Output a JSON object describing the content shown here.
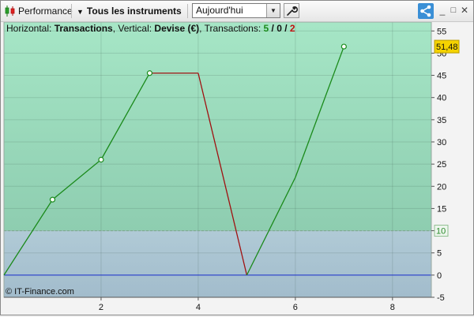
{
  "toolbar": {
    "performance_label": "Performance",
    "instruments_label": "Tous les instruments",
    "period_value": "Aujourd'hui"
  },
  "legend": {
    "horizontal_prefix": "Horizontal: ",
    "horizontal_value": "Transactions",
    "vertical_prefix": ", Vertical: ",
    "vertical_value": "Devise (€)",
    "transactions_prefix": ", Transactions: ",
    "tx_winning": "5",
    "tx_sep1": " / ",
    "tx_neutral": "0",
    "tx_sep2": " / ",
    "tx_losing": "2"
  },
  "copyright": "© IT-Finance.com",
  "colors": {
    "profit_zone": "#a3e0c2",
    "loss_zone": "#a8c4d6",
    "gain_line": "#1a8a1a",
    "loss_line": "#a01010",
    "zero_line": "#1a2fd0",
    "last_value_badge": "#f5d300"
  },
  "icons": [
    "candlestick-icon",
    "chevron-down-icon",
    "wrench-icon",
    "share-icon",
    "minimize-icon",
    "maximize-icon",
    "close-icon"
  ],
  "chart_data": {
    "type": "line",
    "x": [
      0,
      1,
      2,
      3,
      4,
      5,
      6,
      7
    ],
    "y": [
      0,
      17,
      26,
      45.5,
      45.5,
      0,
      22,
      51.48
    ],
    "segment_colors": [
      "gain",
      "gain",
      "gain",
      "flat",
      "loss",
      "gain",
      "gain"
    ],
    "marked_points": [
      1,
      2,
      3,
      7
    ],
    "xlim": [
      0,
      8.8
    ],
    "ylim": [
      -5,
      57
    ],
    "x_ticks": [
      2,
      4,
      6,
      8
    ],
    "y_ticks": [
      55,
      50,
      45,
      40,
      35,
      30,
      25,
      20,
      15,
      10,
      5,
      0,
      -5
    ],
    "threshold": 10,
    "threshold_label": "10",
    "last_value_label": "51,48",
    "grid": true
  }
}
